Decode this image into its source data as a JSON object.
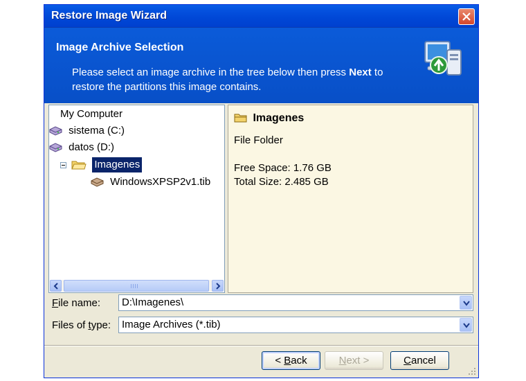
{
  "window": {
    "title": "Restore Image Wizard"
  },
  "header": {
    "title": "Image Archive Selection",
    "description_before": "Please select an image archive in the tree below then press ",
    "description_bold": "Next",
    "description_after": " to restore the partitions this image contains."
  },
  "tree": {
    "items": [
      {
        "label": "My Computer",
        "icon": "computer-icon"
      },
      {
        "label": "sistema (C:)",
        "icon": "drive-icon"
      },
      {
        "label": "datos (D:)",
        "icon": "drive-icon"
      },
      {
        "label": "Imagenes",
        "icon": "folder-open-icon",
        "selected": true,
        "expanded": true
      },
      {
        "label": "WindowsXPSP2v1.tib",
        "icon": "image-archive-icon"
      }
    ]
  },
  "info": {
    "title": "Imagenes",
    "type": "File Folder",
    "free_space": "Free Space: 1.76 GB",
    "total_size": "Total Size: 2.485 GB"
  },
  "form": {
    "file_name_label_accel": "F",
    "file_name_label_rest": "ile name:",
    "file_name_value": "D:\\Imagenes\\",
    "file_type_label_pre": "Files of ",
    "file_type_label_accel": "t",
    "file_type_label_rest": "ype:",
    "file_type_value": "Image Archives (*.tib)"
  },
  "buttons": {
    "back_prefix": "< ",
    "back_accel": "B",
    "back_rest": "ack",
    "next_accel": "N",
    "next_rest": "ext >",
    "cancel_accel": "C",
    "cancel_rest": "ancel"
  },
  "colors": {
    "header_bg": "#084fc7",
    "panel_bg": "#fbf7e3",
    "selection_bg": "#0a246a",
    "close_button": "#d4462a"
  }
}
